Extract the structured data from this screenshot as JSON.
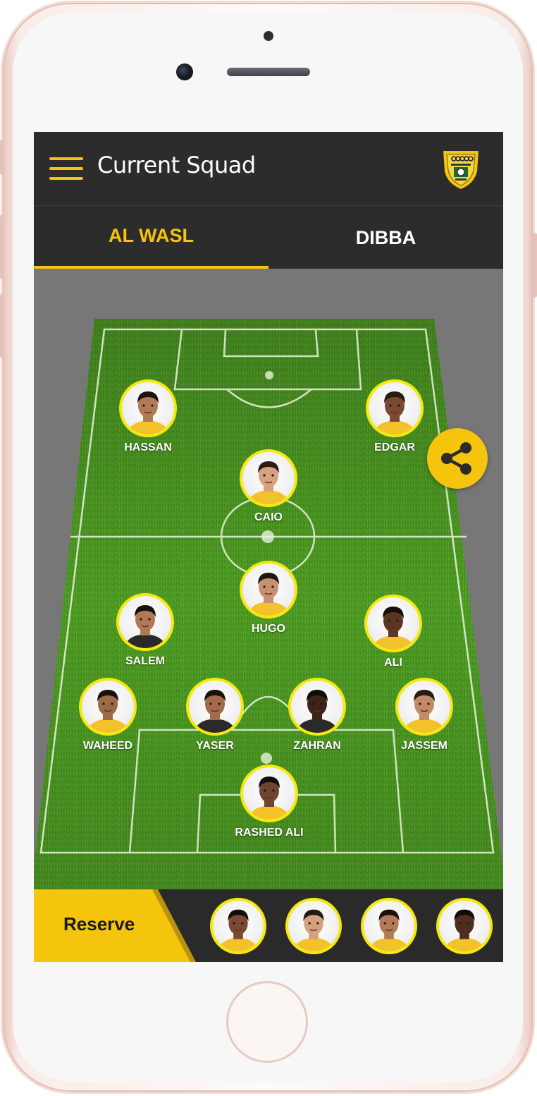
{
  "header": {
    "title": "Current Squad"
  },
  "tabs": [
    {
      "label": "AL WASL",
      "active": true
    },
    {
      "label": "DIBBA",
      "active": false
    }
  ],
  "lineup": [
    {
      "name": "HASSAN",
      "skin": "#b07a55",
      "hair": "#1c1410",
      "kit": "#f3c12a"
    },
    {
      "name": "EDGAR",
      "skin": "#7a4a30",
      "hair": "#2a1a12",
      "kit": "#f3c12a"
    },
    {
      "name": "CAIO",
      "skin": "#d7a27f",
      "hair": "#2a1d16",
      "kit": "#f3c12a"
    },
    {
      "name": "HUGO",
      "skin": "#c99070",
      "hair": "#1e1610",
      "kit": "#f3c12a"
    },
    {
      "name": "SALEM",
      "skin": "#b27754",
      "hair": "#1a120d",
      "kit": "#2a2a2a"
    },
    {
      "name": "ALI",
      "skin": "#5d3623",
      "hair": "#180f0a",
      "kit": "#f3c12a"
    },
    {
      "name": "WAHEED",
      "skin": "#9d6a48",
      "hair": "#18110c",
      "kit": "#f3c12a"
    },
    {
      "name": "YASER",
      "skin": "#a36b4a",
      "hair": "#1a120d",
      "kit": "#2a2a2a"
    },
    {
      "name": "ZAHRAN",
      "skin": "#3e2418",
      "hair": "#120c08",
      "kit": "#2a2a2a"
    },
    {
      "name": "JASSEM",
      "skin": "#c28a67",
      "hair": "#2a1c12",
      "kit": "#f3c12a"
    },
    {
      "name": "RASHED ALI",
      "skin": "#6e4530",
      "hair": "#140d09",
      "kit": "#f3c12a"
    }
  ],
  "reserve": {
    "label": "Reserve",
    "players": [
      {
        "skin": "#7a4a33",
        "hair": "#150e0a",
        "kit": "#f3c12a"
      },
      {
        "skin": "#d4a07e",
        "hair": "#241911",
        "kit": "#f3c12a"
      },
      {
        "skin": "#b37a56",
        "hair": "#1a120d",
        "kit": "#f3c12a"
      },
      {
        "skin": "#4f2e1f",
        "hair": "#120c08",
        "kit": "#f3c12a"
      }
    ]
  },
  "colors": {
    "accent": "#f5c40c",
    "appbar": "#2d2c2c",
    "pitch": "#4f9a22",
    "avatar_ring": "#f5e90c"
  },
  "icons": {
    "menu": "hamburger-icon",
    "crest": "club-crest-logo",
    "share": "share-icon"
  }
}
